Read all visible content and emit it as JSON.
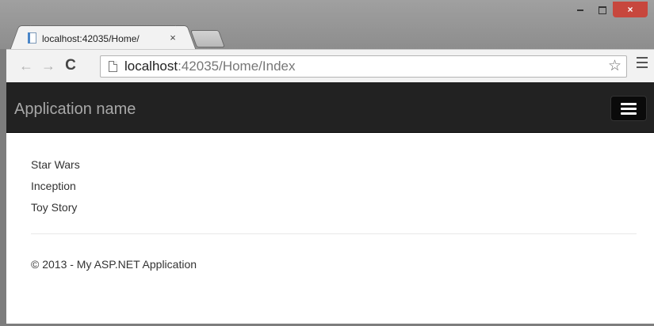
{
  "browser": {
    "tab": {
      "title": "localhost:42035/Home/",
      "close": "×"
    },
    "window_controls": {
      "close": "×"
    },
    "address_bar": {
      "host": "localhost",
      "rest": ":42035/Home/Index"
    },
    "icons": {
      "back": "back-arrow-icon",
      "forward": "forward-arrow-icon",
      "reload": "reload-icon",
      "star": "bookmark-star-icon",
      "menu": "hamburger-menu-icon"
    }
  },
  "page": {
    "brand": "Application name",
    "movies": [
      "Star Wars",
      "Inception",
      "Toy Story"
    ],
    "footer": "© 2013 - My ASP.NET Application"
  },
  "colors": {
    "navbar_bg": "#222222",
    "brand_text": "#a8a8a8",
    "window_frame": "#7d7d7d",
    "close_button": "#c7473d"
  }
}
